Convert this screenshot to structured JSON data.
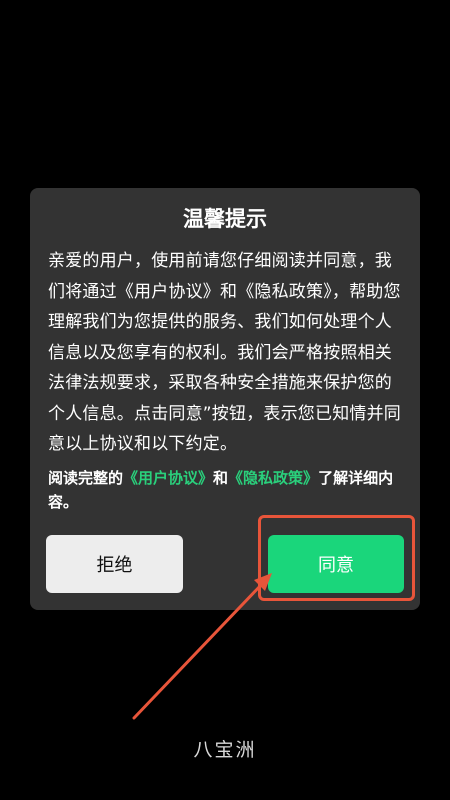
{
  "dialog": {
    "title": "温馨提示",
    "body": "亲爱的用户，使用前请您仔细阅读并同意，我们将通过《用户协议》和《隐私政策》，帮助您理解我们为您提供的服务、我们如何处理个人信息以及您享有的权利。我们会严格按照相关法律法规要求，采取各种安全措施来保护您的个人信息。点击同意”按钮，表示您已知情并同意以上协议和以下约定。",
    "note": {
      "prefix": "阅读完整的",
      "user_agreement_link": "《用户协议》",
      "conjunction": "和",
      "privacy_policy_link": "《隐私政策》",
      "suffix": "了解详细内容。"
    },
    "reject_label": "拒绝",
    "agree_label": "同意"
  },
  "app": {
    "name": "八宝洲"
  },
  "colors": {
    "background": "#000000",
    "dialog_background": "#333333",
    "link": "#2ad07c",
    "agree_button": "#1ad67b",
    "reject_button": "#ededed",
    "annotation": "#e8553a"
  }
}
